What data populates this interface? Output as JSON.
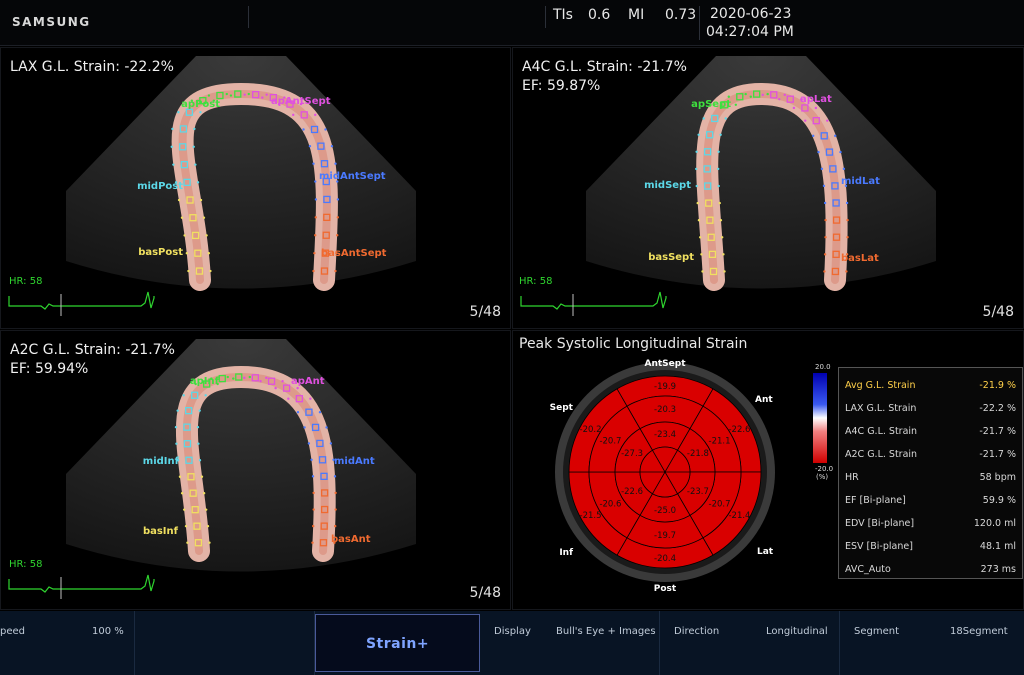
{
  "header": {
    "brand": "SAMSUNG",
    "tis_label": "TIs",
    "tis_value": "0.6",
    "mi_label": "MI",
    "mi_value": "0.73",
    "date": "2020-06-23",
    "time": "04:27:04 PM"
  },
  "panels": {
    "lax": {
      "title": "LAX G.L. Strain: -22.2%",
      "subtitle": "",
      "hr": "HR: 58",
      "frame": "5/48",
      "labels": {
        "ap_left": "apPost",
        "ap_right": "apAntSept",
        "mid_left": "midPost",
        "mid_right": "midAntSept",
        "bas_left": "basPost",
        "bas_right": "basAntSept"
      }
    },
    "a4c": {
      "title": "A4C G.L. Strain: -21.7%",
      "subtitle": "EF: 59.87%",
      "hr": "HR: 58",
      "frame": "5/48",
      "labels": {
        "ap_left": "apSept",
        "ap_right": "apLat",
        "mid_left": "midSept",
        "mid_right": "midLat",
        "bas_left": "basSept",
        "bas_right": "basLat"
      }
    },
    "a2c": {
      "title": "A2C G.L. Strain: -21.7%",
      "subtitle": "EF: 59.94%",
      "hr": "HR: 58",
      "frame": "5/48",
      "labels": {
        "ap_left": "apInf",
        "ap_right": "apAnt",
        "mid_left": "midInf",
        "mid_right": "midAnt",
        "bas_left": "basInf",
        "bas_right": "basAnt"
      }
    }
  },
  "bullseye": {
    "title": "Peak Systolic Longitudinal Strain",
    "labels": {
      "top": "AntSept",
      "ant": "Ant",
      "lat": "Lat",
      "bottom": "Post",
      "inf": "Inf",
      "sept": "Sept"
    },
    "basal": [
      "-19.9",
      "-22.6",
      "-21.4",
      "-20.4",
      "-21.5",
      "-20.2"
    ],
    "mid": [
      "-20.3",
      "-21.1",
      "-20.7",
      "-19.7",
      "-20.6",
      "-20.7"
    ],
    "apical": [
      "-23.4",
      "-21.8",
      "-23.7",
      "-25.0",
      "-22.6",
      "-27.3"
    ],
    "colorbar_max": "20.0",
    "colorbar_min": "-20.0",
    "colorbar_unit": "(%)",
    "fill_color": "#d90000"
  },
  "legend": [
    {
      "label": "Avg G.L. Strain",
      "value": "-21.9 %"
    },
    {
      "label": "LAX G.L. Strain",
      "value": "-22.2 %"
    },
    {
      "label": "A4C G.L. Strain",
      "value": "-21.7 %"
    },
    {
      "label": "A2C G.L. Strain",
      "value": "-21.7 %"
    },
    {
      "label": "HR",
      "value": "58 bpm"
    },
    {
      "label": "EF [Bi-plane]",
      "value": "59.9 %"
    },
    {
      "label": "EDV [Bi-plane]",
      "value": "120.0 ml"
    },
    {
      "label": "ESV [Bi-plane]",
      "value": "48.1 ml"
    },
    {
      "label": "AVC_Auto",
      "value": "273 ms"
    }
  ],
  "bottom": {
    "speed_label": "peed",
    "speed_value": "100 %",
    "strain_button": "Strain+",
    "display_label": "Display",
    "display_value": "Bull's Eye + Images",
    "direction_label": "Direction",
    "direction_value": "Longitudinal",
    "segment_label": "Segment",
    "segment_value": "18Segment"
  },
  "colors": {
    "ecg": "#2fd52f",
    "label_green": "#3ee03e",
    "label_magenta": "#e050e0",
    "label_cyan": "#5cd8e8",
    "label_blue": "#4a7aff",
    "label_yellow": "#f0e060",
    "label_orange": "#f06a30"
  }
}
